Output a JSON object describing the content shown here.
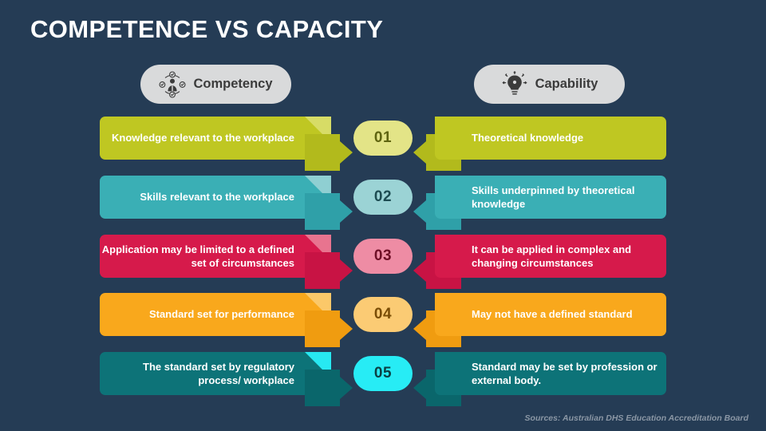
{
  "page_title": "Competence vs Capacity",
  "background_color": "#253c55",
  "header": {
    "left_pill": {
      "label": "Competency",
      "icon": "competency-person-check-icon",
      "bg": "#d9dadb"
    },
    "right_pill": {
      "label": "Capability",
      "icon": "capability-lightbulb-gear-icon",
      "bg": "#d9dadb"
    }
  },
  "rows": [
    {
      "number": "01",
      "color": "#bfc722",
      "fold_color": "#d7dc66",
      "tab_color": "#b2ba1c",
      "badge_bg": "#e3e487",
      "badge_text_color": "#5f6410",
      "left_text": "Knowledge relevant to the workplace",
      "right_text": "Theoretical knowledge"
    },
    {
      "number": "02",
      "color": "#3aafb5",
      "fold_color": "#8fcfd2",
      "tab_color": "#2fa0a8",
      "badge_bg": "#9bd3d5",
      "badge_text_color": "#1d4c52",
      "left_text": "Skills relevant to the workplace",
      "right_text": "Skills underpinned by theoretical knowledge"
    },
    {
      "number": "03",
      "color": "#d61a4b",
      "fold_color": "#e8748f",
      "tab_color": "#c81344",
      "badge_bg": "#ee8ca4",
      "badge_text_color": "#6e0f26",
      "left_text": "Application may be limited to a defined set of circumstances",
      "right_text": "It can be applied in complex and changing circumstances"
    },
    {
      "number": "04",
      "color": "#f9a81c",
      "fold_color": "#fbc869",
      "tab_color": "#f09c10",
      "badge_bg": "#fbcb74",
      "badge_text_color": "#7a4d05",
      "left_text": "Standard set for performance",
      "right_text": "May not have a defined standard"
    },
    {
      "number": "05",
      "color": "#0d7378",
      "fold_color": "#27e9f2",
      "tab_color": "#0a666b",
      "badge_bg": "#27ecf5",
      "badge_text_color": "#0b3f43",
      "left_text": "The standard set by regulatory process/ workplace",
      "right_text": "Standard may be set by profession or external body."
    }
  ],
  "footer": {
    "source": "Sources: Australian DHS Education Accreditation Board"
  }
}
